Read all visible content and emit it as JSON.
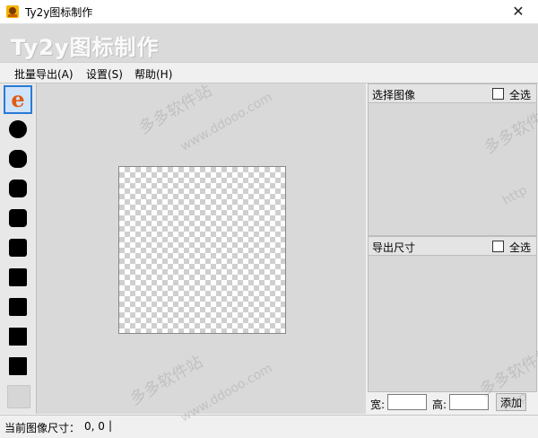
{
  "window": {
    "title": "Ty2y图标制作",
    "close_glyph": "✕"
  },
  "banner": {
    "title": "Ty2y图标制作"
  },
  "menu": {
    "items": [
      "批量导出(A)",
      "设置(S)",
      "帮助(H)"
    ]
  },
  "panels": {
    "select_image": {
      "title": "选择图像",
      "select_all": "全选"
    },
    "export_size": {
      "title": "导出尺寸",
      "select_all": "全选"
    }
  },
  "size_inputs": {
    "width_label": "宽:",
    "width_value": "",
    "height_label": "高:",
    "height_value": "",
    "add_button": "添加"
  },
  "status": {
    "label": "当前图像尺寸：",
    "value": "0, 0",
    "separator": "|"
  },
  "watermarks": [
    "多多软件站",
    "www.ddooo.com",
    "多多软件站",
    "http",
    "多多软件站",
    "www.ddooo.com",
    "多多软件站",
    "http"
  ],
  "colors": {
    "accent": "#2a7ad6",
    "logo_orange": "#e25b12"
  },
  "icons": {
    "toolbox": [
      "ie-logo-icon",
      "circle-shape-icon",
      "rounded-square-large-icon",
      "rounded-square-medium-icon",
      "rounded-square-icon",
      "rounded-square-small-icon",
      "square-icon",
      "square-icon",
      "square-icon",
      "square-icon",
      "empty-slot"
    ]
  }
}
